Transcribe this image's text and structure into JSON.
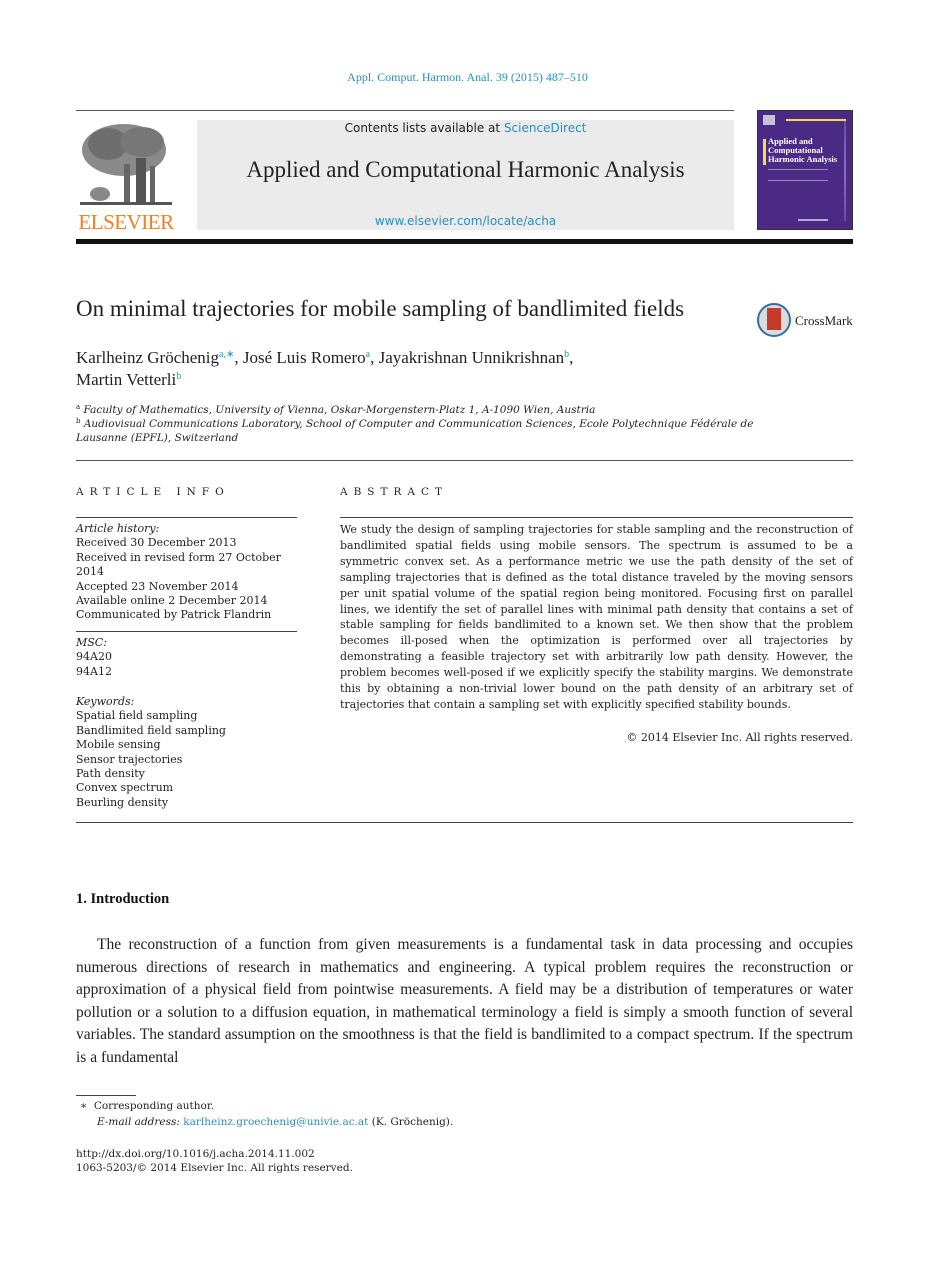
{
  "journal_ref": "Appl. Comput. Harmon. Anal. 39 (2015) 487–510",
  "header": {
    "publisher_logo_text": "ELSEVIER",
    "contents_prefix": "Contents lists available at ",
    "contents_link": "ScienceDirect",
    "journal_title": "Applied and Computational Harmonic Analysis",
    "journal_url": "www.elsevier.com/locate/acha",
    "cover_title": "Applied and Computational Harmonic Analysis",
    "colors": {
      "link": "#2a8fb9",
      "elsevier_orange": "#f07e22",
      "cover_purple": "#4b2a86"
    }
  },
  "article": {
    "title": "On minimal trajectories for mobile sampling of bandlimited fields",
    "crossmark_label": "CrossMark",
    "authors": [
      {
        "name": "Karlheinz Gröchenig",
        "sup": "a,∗",
        "sep": ", "
      },
      {
        "name": "José Luis Romero",
        "sup": "a",
        "sep": ", "
      },
      {
        "name": "Jayakrishnan Unnikrishnan",
        "sup": "b",
        "sep": ","
      },
      {
        "name": "Martin Vetterli",
        "sup": "b",
        "sep": ""
      }
    ],
    "affiliations": [
      {
        "mark": "a",
        "text": "Faculty of Mathematics, University of Vienna, Oskar-Morgenstern-Platz 1, A-1090 Wien, Austria"
      },
      {
        "mark": "b",
        "text": "Audiovisual Communications Laboratory, School of Computer and Communication Sciences, Ecole Polytechnique Fédérale de Lausanne (EPFL), Switzerland"
      }
    ]
  },
  "article_info": {
    "heading": "ARTICLE INFO",
    "history_label": "Article history:",
    "history": [
      "Received 30 December 2013",
      "Received in revised form 27 October 2014",
      "Accepted 23 November 2014",
      "Available online 2 December 2014",
      "Communicated by Patrick Flandrin"
    ],
    "msc_label": "MSC:",
    "msc": [
      "94A20",
      "94A12"
    ],
    "keywords_label": "Keywords:",
    "keywords": [
      "Spatial field sampling",
      "Bandlimited field sampling",
      "Mobile sensing",
      "Sensor trajectories",
      "Path density",
      "Convex spectrum",
      "Beurling density"
    ]
  },
  "abstract": {
    "heading": "ABSTRACT",
    "text": "We study the design of sampling trajectories for stable sampling and the reconstruction of bandlimited spatial fields using mobile sensors. The spectrum is assumed to be a symmetric convex set. As a performance metric we use the path density of the set of sampling trajectories that is defined as the total distance traveled by the moving sensors per unit spatial volume of the spatial region being monitored. Focusing first on parallel lines, we identify the set of parallel lines with minimal path density that contains a set of stable sampling for fields bandlimited to a known set. We then show that the problem becomes ill-posed when the optimization is performed over all trajectories by demonstrating a feasible trajectory set with arbitrarily low path density. However, the problem becomes well-posed if we explicitly specify the stability margins. We demonstrate this by obtaining a non-trivial lower bound on the path density of an arbitrary set of trajectories that contain a sampling set with explicitly specified stability bounds.",
    "copyright": "© 2014 Elsevier Inc. All rights reserved."
  },
  "introduction": {
    "heading": "1. Introduction",
    "text": "The reconstruction of a function from given measurements is a fundamental task in data processing and occupies numerous directions of research in mathematics and engineering. A typical problem requires the reconstruction or approximation of a physical field from pointwise measurements. A field may be a distribution of temperatures or water pollution or a solution to a diffusion equation, in mathematical terminology a field is simply a smooth function of several variables. The standard assumption on the smoothness is that the field is bandlimited to a compact spectrum. If the spectrum is a fundamental"
  },
  "footnotes": {
    "star_mark": "∗",
    "corresponding": "Corresponding author.",
    "email_label": "E-mail address:",
    "email": "karlheinz.groechenig@univie.ac.at",
    "email_owner": " (K. Gröchenig).",
    "doi": "http://dx.doi.org/10.1016/j.acha.2014.11.002",
    "issn_line": "1063-5203/© 2014 Elsevier Inc. All rights reserved."
  }
}
